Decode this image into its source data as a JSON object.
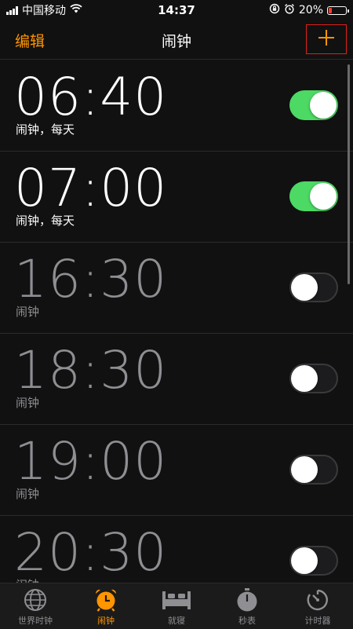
{
  "status_bar": {
    "carrier": "中国移动",
    "time": "14:37",
    "battery_percent": "20%",
    "battery_level": 0.2
  },
  "nav": {
    "edit_label": "编辑",
    "title": "闹钟",
    "add_icon": "plus-icon"
  },
  "alarms": [
    {
      "time": "06:40",
      "label": "闹钟，每天",
      "enabled": true
    },
    {
      "time": "07:00",
      "label": "闹钟，每天",
      "enabled": true
    },
    {
      "time": "16:30",
      "label": "闹钟",
      "enabled": false
    },
    {
      "time": "18:30",
      "label": "闹钟",
      "enabled": false
    },
    {
      "time": "19:00",
      "label": "闹钟",
      "enabled": false
    },
    {
      "time": "20:30",
      "label": "闹钟",
      "enabled": false
    }
  ],
  "tabs": [
    {
      "label": "世界时钟",
      "icon": "globe-icon",
      "active": false
    },
    {
      "label": "闹钟",
      "icon": "alarm-clock-icon",
      "active": true
    },
    {
      "label": "就寝",
      "icon": "bed-icon",
      "active": false
    },
    {
      "label": "秒表",
      "icon": "stopwatch-icon",
      "active": false
    },
    {
      "label": "计时器",
      "icon": "timer-icon",
      "active": false
    }
  ],
  "colors": {
    "accent": "#ff9500",
    "toggle_on": "#4cd964",
    "highlight_border": "#e0201b"
  }
}
